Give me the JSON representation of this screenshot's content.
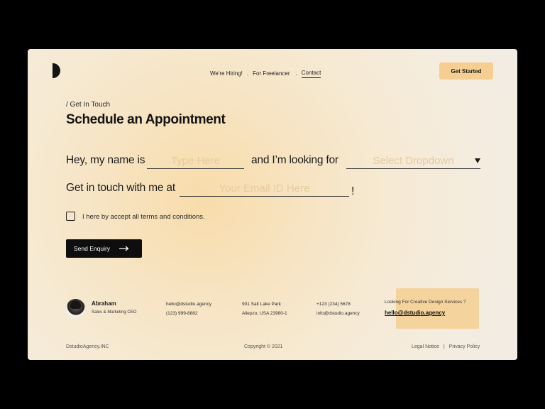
{
  "nav": {
    "items": [
      "We're Hiring!",
      "For Freelancer",
      "Contact"
    ],
    "separator": ".",
    "cta_label": "Get Started"
  },
  "breadcrumb": "/ Get In Touch",
  "title": "Schedule an Appointment",
  "form": {
    "name_prefix": "Hey, my name is",
    "name_placeholder": "Type Here",
    "looking_text": "and I’m looking for",
    "select_placeholder": "Select Dropdown",
    "email_prefix": "Get in touch with me at",
    "email_placeholder": "Your Email ID Here",
    "email_suffix": "!",
    "terms_label": "I here by accept all terms and conditions.",
    "terms_checked": false,
    "send_label": "Send Enquiry"
  },
  "contact_person": {
    "name": "Abraham",
    "role": "Sales & Marketing CEO",
    "email": "hello@dstudio.agency",
    "phone": "(123) 999-8882"
  },
  "address": {
    "line1": "901 Salt Lake Park",
    "line2": "Allepzo, USA 23980-1"
  },
  "company_contact": {
    "phone": "+123 (234) 5678",
    "email": "info@dstudio.agency"
  },
  "cta": {
    "question": "Looking For Creative Design Services ?",
    "email": "hello@dstudio.agency"
  },
  "bottom": {
    "brand": "DstudioAgency.INC",
    "copyright": "Copyright © 2021",
    "legal": "Legal Notice",
    "separator": "|",
    "privacy": "Privacy Policy"
  },
  "colors": {
    "accent": "#f5cf92",
    "button_dark": "#0e0e0e",
    "placeholder": "#e6cba0"
  }
}
